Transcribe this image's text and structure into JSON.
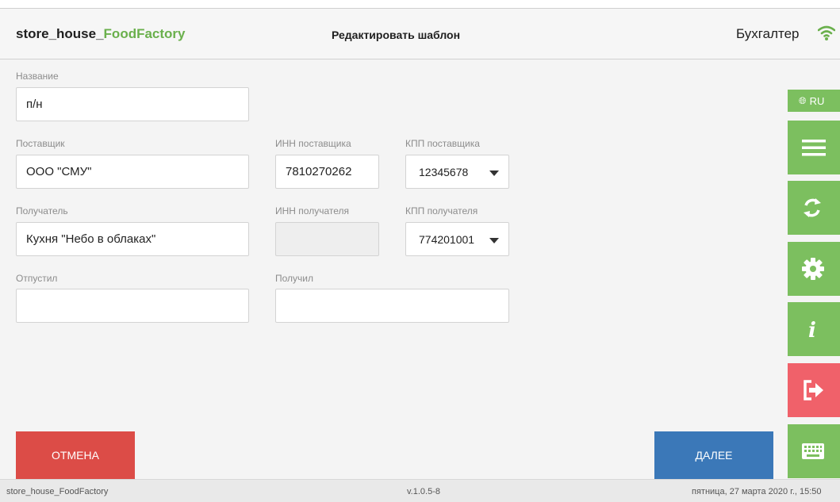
{
  "header": {
    "app_title_prefix": "store_house_",
    "app_title_accent": "FoodFactory",
    "page_title": "Редактировать шаблон",
    "user": "Бухгалтер",
    "wifi_icon": "wifi-icon"
  },
  "form": {
    "name_label": "Название",
    "name_value": "п/н",
    "supplier_label": "Поставщик",
    "supplier_value": "ООО \"СМУ\"",
    "supplier_inn_label": "ИНН поставщика",
    "supplier_inn_value": "7810270262",
    "supplier_kpp_label": "КПП поставщика",
    "supplier_kpp_value": "12345678",
    "recipient_label": "Получатель",
    "recipient_value": "Кухня \"Небо в облаках\"",
    "recipient_inn_label": "ИНН получателя",
    "recipient_inn_value": "",
    "recipient_kpp_label": "КПП получателя",
    "recipient_kpp_value": "774201001",
    "released_label": "Отпустил",
    "released_value": "",
    "received_label": "Получил",
    "received_value": ""
  },
  "sidebar": {
    "lang_label": "RU",
    "lang_icon": "globe-icon",
    "items": [
      {
        "name": "menu",
        "icon": "hamburger-icon"
      },
      {
        "name": "sync",
        "icon": "sync-icon"
      },
      {
        "name": "settings",
        "icon": "gear-icon"
      },
      {
        "name": "info",
        "icon": "info-icon"
      },
      {
        "name": "logout",
        "icon": "logout-icon"
      },
      {
        "name": "keyboard",
        "icon": "keyboard-icon"
      }
    ],
    "colors": {
      "green": "#7cbf5f",
      "red": "#f0616a"
    }
  },
  "actions": {
    "cancel_label": "Отмена",
    "next_label": "Далее",
    "cancel_color": "#dc4c47",
    "next_color": "#3b78b8"
  },
  "footer": {
    "app": "store_house_FoodFactory",
    "version": "v.1.0.5-8",
    "datetime": "пятница, 27 марта 2020 г., 15:50"
  }
}
